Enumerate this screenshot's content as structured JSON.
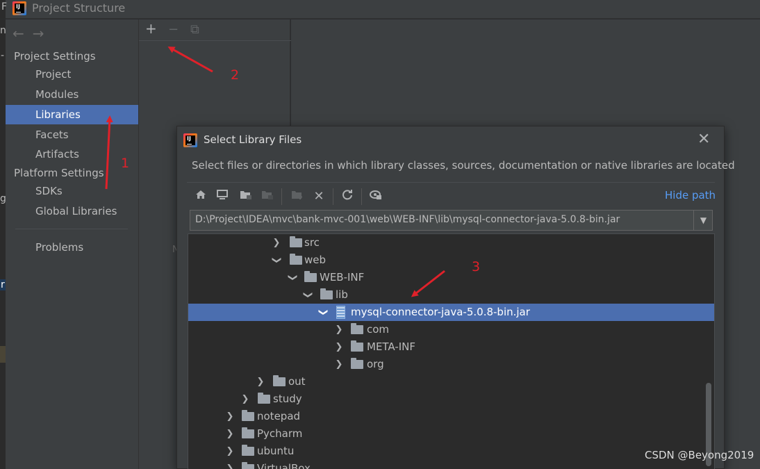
{
  "window": {
    "title": "Project Structure"
  },
  "background_fragments": [
    "F",
    "n",
    "-",
    "g",
    "r"
  ],
  "sidebar": {
    "sections": [
      {
        "label": "Project Settings"
      },
      {
        "label": "Platform Settings"
      }
    ],
    "items": [
      {
        "label": "Project"
      },
      {
        "label": "Modules"
      },
      {
        "label": "Libraries",
        "selected": true
      },
      {
        "label": "Facets"
      },
      {
        "label": "Artifacts"
      },
      {
        "label": "SDKs"
      },
      {
        "label": "Global Libraries"
      },
      {
        "label": "Problems"
      }
    ],
    "nav": {
      "back": "←",
      "forward": "→"
    }
  },
  "middle_toolbar": {
    "add": "+",
    "remove": "−",
    "copy": "⧉"
  },
  "middle_stub": "N",
  "dialog": {
    "title": "Select Library Files",
    "description": "Select files or directories in which library classes, sources, documentation or native libraries are located",
    "hide_path_label": "Hide path",
    "path": "D:\\Project\\IDEA\\mvc\\bank-mvc-001\\web\\WEB-INF\\lib\\mysql-connector-java-5.0.8-bin.jar",
    "tree": [
      {
        "label": "src",
        "expanded": false
      },
      {
        "label": "web",
        "expanded": true
      },
      {
        "label": "WEB-INF",
        "expanded": true
      },
      {
        "label": "lib",
        "expanded": true
      },
      {
        "label": "mysql-connector-java-5.0.8-bin.jar",
        "expanded": true,
        "selected": true,
        "icon": "jar-icon"
      },
      {
        "label": "com",
        "expanded": false
      },
      {
        "label": "META-INF",
        "expanded": false
      },
      {
        "label": "org",
        "expanded": false
      },
      {
        "label": "out",
        "expanded": false
      },
      {
        "label": "study",
        "expanded": false
      },
      {
        "label": "notepad",
        "expanded": false
      },
      {
        "label": "Pycharm",
        "expanded": false
      },
      {
        "label": "ubuntu",
        "expanded": false
      },
      {
        "label": "VirtualBox",
        "expanded": false
      }
    ],
    "toolbar_icons": [
      "home-icon",
      "desktop-icon",
      "project-folder-icon",
      "module-folder-icon",
      "new-folder-icon",
      "delete-icon",
      "refresh-icon",
      "show-hidden-icon"
    ]
  },
  "annotations": {
    "one": "1",
    "two": "2",
    "three": "3",
    "color": "#e0212a"
  },
  "watermark": "CSDN @Beyong2019"
}
